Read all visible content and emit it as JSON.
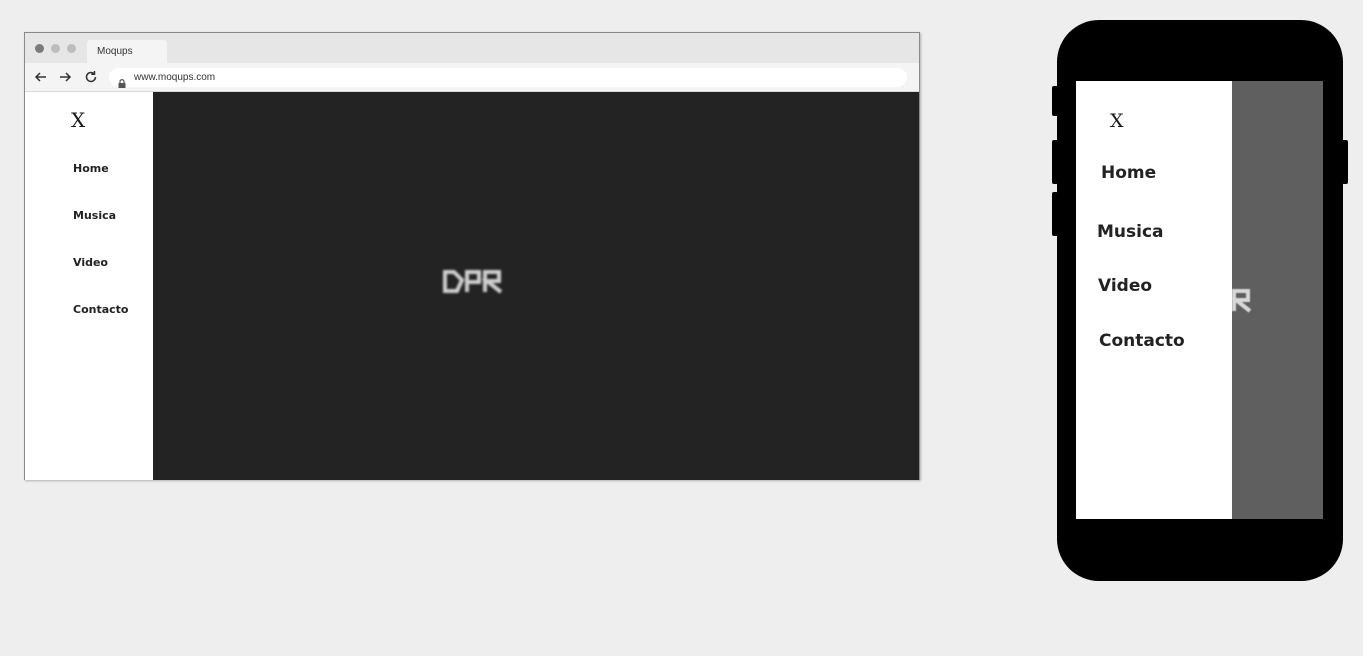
{
  "browser": {
    "tab_title": "Moqups",
    "url": "www.moqups.com",
    "nav_icons": {
      "back": "arrow-left-icon",
      "forward": "arrow-right-icon",
      "reload": "reload-icon",
      "lock": "lock-icon"
    },
    "window_dots": [
      "#7a7a7a",
      "#bdbdbd",
      "#bdbdbd"
    ]
  },
  "site": {
    "close_label": "X",
    "menu": [
      {
        "label": "Home"
      },
      {
        "label": "Musica"
      },
      {
        "label": "Video"
      },
      {
        "label": "Contacto"
      }
    ],
    "logo_text": "DPR",
    "colors": {
      "background": "#232323",
      "sidebar": "#ffffff",
      "overlay": "#5f5f5f",
      "text": "#222222"
    }
  },
  "phone": {
    "close_label": "X",
    "menu": [
      {
        "label": "Home"
      },
      {
        "label": "Musica"
      },
      {
        "label": "Video"
      },
      {
        "label": "Contacto"
      }
    ]
  }
}
